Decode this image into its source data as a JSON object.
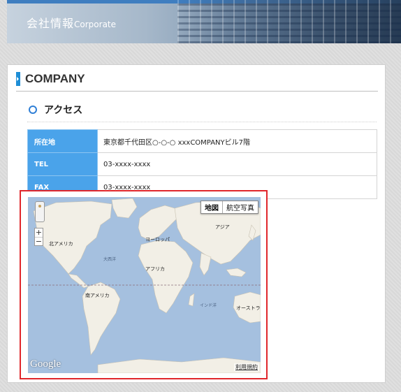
{
  "banner": {
    "title_ja": "会社情報",
    "title_en": "Corporate"
  },
  "section": {
    "title": "COMPANY"
  },
  "subsection": {
    "title": "アクセス"
  },
  "info_rows": [
    {
      "label": "所在地",
      "value": "東京都千代田区○-○-○ xxxCOMPANYビル7階"
    },
    {
      "label": "TEL",
      "value": "03-xxxx-xxxx"
    },
    {
      "label": "FAX",
      "value": "03-xxxx-xxxx"
    }
  ],
  "map": {
    "type_buttons": [
      "地図",
      "航空写真"
    ],
    "selected_type": "地図",
    "zoom_in": "+",
    "zoom_out": "−",
    "logo": "Google",
    "terms": "利用規約",
    "labels": {
      "north_america": "北アメリカ",
      "europe": "ヨーロッパ",
      "asia": "アジア",
      "atlantic": "大西洋",
      "africa": "アフリカ",
      "south_america": "南アメリカ",
      "indian_ocean": "インド洋",
      "oceania": "オーストラ"
    },
    "colors": {
      "ocean": "#a5c0df",
      "land": "#f2efe6"
    }
  },
  "highlight_color": "#e0262b",
  "accent_color": "#4aa3ea"
}
